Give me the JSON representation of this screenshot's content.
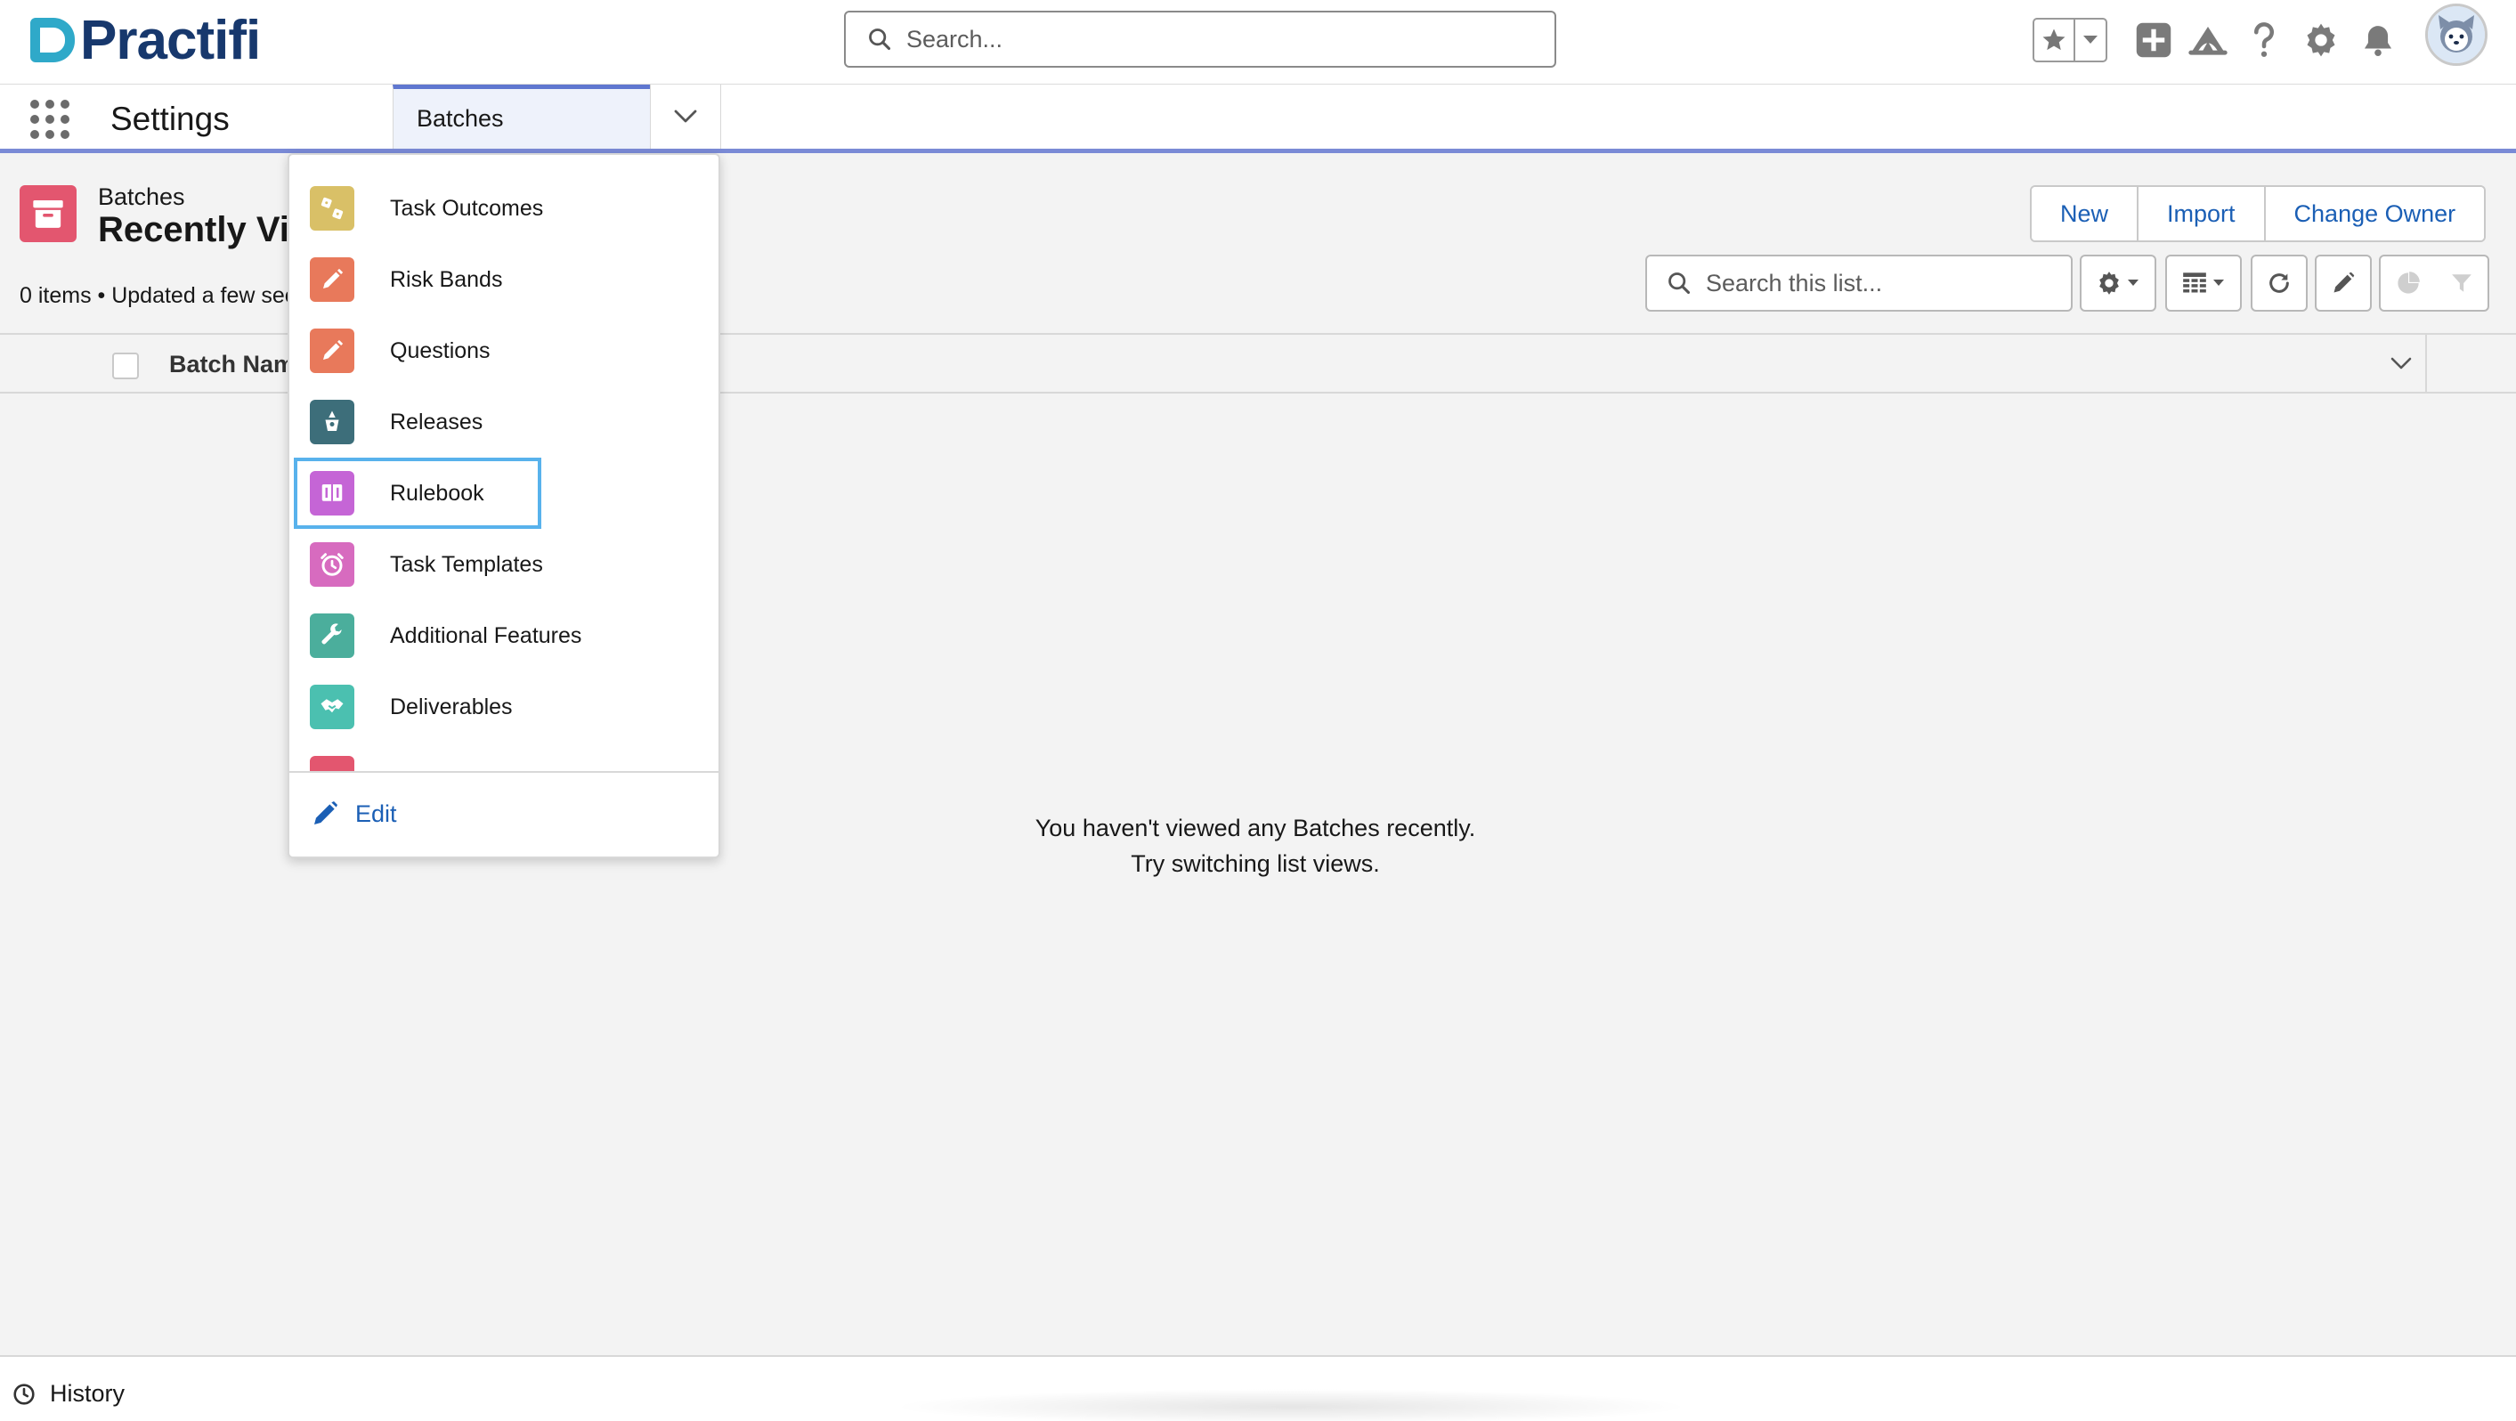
{
  "brand": {
    "name": "Practifi"
  },
  "global_search": {
    "placeholder": "Search..."
  },
  "header_icons": [
    "star-icon",
    "chevron-down-icon",
    "add-icon",
    "trailhead-icon",
    "help-icon",
    "gear-icon",
    "bell-icon",
    "avatar"
  ],
  "nav": {
    "app_name": "Settings",
    "active_tab": "Batches"
  },
  "list_view": {
    "object_label": "Batches",
    "title": "Recently Viewed",
    "meta": "0 items • Updated a few seconds ago",
    "buttons": {
      "new": "New",
      "import": "Import",
      "change_owner": "Change Owner"
    },
    "search_placeholder": "Search this list...",
    "column_header": "Batch Name",
    "empty_line1": "You haven't viewed any Batches recently.",
    "empty_line2": "Try switching list views."
  },
  "menu": {
    "items": [
      {
        "label": "Task Outcomes",
        "color": "#d9c067"
      },
      {
        "label": "Risk Bands",
        "color": "#e8795b"
      },
      {
        "label": "Questions",
        "color": "#e8795b"
      },
      {
        "label": "Releases",
        "color": "#3d6e7a"
      },
      {
        "label": "Rulebook",
        "color": "#c565d6"
      },
      {
        "label": "Task Templates",
        "color": "#d76bbf"
      },
      {
        "label": "Additional Features",
        "color": "#4bae9c"
      },
      {
        "label": "Deliverables",
        "color": "#4bc0b0"
      }
    ],
    "edit_label": "Edit"
  },
  "footer": {
    "history_label": "History"
  },
  "colors": {
    "accent": "#1b5fb5",
    "nav_underline": "#7a8ad6",
    "object_icon": "#e3566f",
    "focus_ring": "#58b2ec"
  }
}
